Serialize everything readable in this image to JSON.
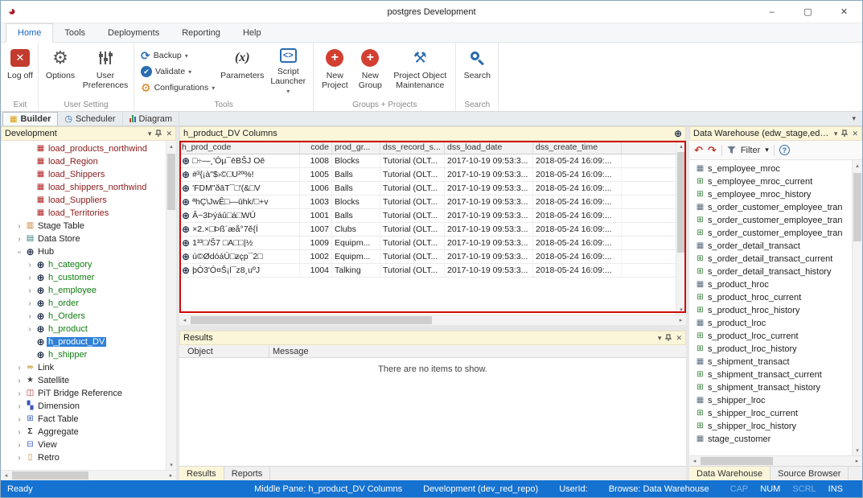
{
  "window": {
    "title": "postgres  Development"
  },
  "colors": {
    "accent": "#1e66c1",
    "statusbar": "#1572d0",
    "selection": "#2f80d8",
    "annotation": "#cf0a0a",
    "panel_header": "#fbf6d9",
    "load_text": "#8b1a1a",
    "hub_object_text": "#107c10"
  },
  "icons": {
    "logo": "◕",
    "minimize": "–",
    "maximize": "▢",
    "close": "✕",
    "chevron_down": "▾",
    "chevron_up": "▴",
    "chevron_left": "◂",
    "chevron_right": "▸",
    "expander": "›",
    "logoff": "✕",
    "gear": "⚙",
    "backup": "⟳",
    "check": "✔",
    "parameters": "(x)",
    "script": "<>",
    "plus": "+",
    "wrench": "⚒",
    "builder": "▦",
    "scheduler": "◷",
    "hub": "⊕",
    "load": "▦",
    "stage": "▥",
    "dstore": "▤",
    "link": "∞",
    "sat": "★",
    "pit": "◫",
    "dim": "▚",
    "fact": "⊞",
    "agg": "Σ",
    "view": "⊟",
    "retro": "▯",
    "table": "▦",
    "dwview": "⊞",
    "undo": "↶",
    "redo": "↷",
    "help": "?"
  },
  "menu": {
    "tabs": [
      "Home",
      "Tools",
      "Deployments",
      "Reporting",
      "Help"
    ],
    "selected_index": 0
  },
  "ribbon": {
    "exit": {
      "label": "Exit",
      "logoff": "Log off"
    },
    "user_setting": {
      "label": "User Setting",
      "options": "Options",
      "user_preferences": "User Preferences"
    },
    "tools": {
      "label": "Tools",
      "backup": "Backup",
      "validate": "Validate",
      "configurations": "Configurations",
      "parameters": "Parameters",
      "script_launcher": "Script Launcher"
    },
    "groups_projects": {
      "label": "Groups + Projects",
      "new_project": "New Project",
      "new_group": "New Group",
      "maintenance": "Project Object Maintenance"
    },
    "search": {
      "label": "Search",
      "search": "Search"
    }
  },
  "view_tabs": {
    "tabs": [
      "Builder",
      "Scheduler",
      "Diagram"
    ],
    "selected": "Builder"
  },
  "panels": {
    "development": {
      "title": "Development"
    },
    "columns": {
      "title": "h_product_DV Columns"
    },
    "results": {
      "title": "Results",
      "columns": [
        "Object",
        "Message"
      ],
      "empty_text": "There are no items to show.",
      "tabs": [
        "Results",
        "Reports"
      ],
      "selected_tab": "Results"
    },
    "browser": {
      "title": "Data Warehouse (edw_stage,edw_ods...",
      "filter_label": "Filter",
      "tabs": [
        "Data Warehouse",
        "Source Browser"
      ],
      "selected_tab": "Data Warehouse"
    }
  },
  "dev_tree": {
    "items": [
      {
        "label": "load_products_northwind",
        "icon": "load",
        "indent": 2,
        "cls": "load"
      },
      {
        "label": "load_Region",
        "icon": "load",
        "indent": 2,
        "cls": "load"
      },
      {
        "label": "load_Shippers",
        "icon": "load",
        "indent": 2,
        "cls": "load"
      },
      {
        "label": "load_shippers_northwind",
        "icon": "load",
        "indent": 2,
        "cls": "load"
      },
      {
        "label": "load_Suppliers",
        "icon": "load",
        "indent": 2,
        "cls": "load"
      },
      {
        "label": "load_Territories",
        "icon": "load",
        "indent": 2,
        "cls": "load"
      },
      {
        "label": "Stage Table",
        "icon": "stage",
        "indent": 1,
        "expander": "collapsed"
      },
      {
        "label": "Data Store",
        "icon": "dstore",
        "indent": 1,
        "expander": "collapsed"
      },
      {
        "label": "Hub",
        "icon": "hub",
        "indent": 1,
        "expander": "expanded"
      },
      {
        "label": "h_category",
        "icon": "hub",
        "indent": 2,
        "expander": "collapsed",
        "cls": "hubobj"
      },
      {
        "label": "h_customer",
        "icon": "hub",
        "indent": 2,
        "expander": "collapsed",
        "cls": "hubobj"
      },
      {
        "label": "h_employee",
        "icon": "hub",
        "indent": 2,
        "expander": "collapsed",
        "cls": "hubobj"
      },
      {
        "label": "h_order",
        "icon": "hub",
        "indent": 2,
        "expander": "collapsed",
        "cls": "hubobj"
      },
      {
        "label": "h_Orders",
        "icon": "hub",
        "indent": 2,
        "expander": "collapsed",
        "cls": "hubobj"
      },
      {
        "label": "h_product",
        "icon": "hub",
        "indent": 2,
        "expander": "collapsed",
        "cls": "hubobj"
      },
      {
        "label": "h_product_DV",
        "icon": "hub",
        "indent": 2,
        "cls": "hubobj",
        "selected": true
      },
      {
        "label": "h_shipper",
        "icon": "hub",
        "indent": 2,
        "cls": "hubobj"
      },
      {
        "label": "Link",
        "icon": "link",
        "indent": 1,
        "expander": "collapsed"
      },
      {
        "label": "Satellite",
        "icon": "sat",
        "indent": 1,
        "expander": "collapsed"
      },
      {
        "label": "PiT Bridge Reference",
        "icon": "pit",
        "indent": 1,
        "expander": "collapsed"
      },
      {
        "label": "Dimension",
        "icon": "dim",
        "indent": 1,
        "expander": "collapsed"
      },
      {
        "label": "Fact Table",
        "icon": "fact",
        "indent": 1,
        "expander": "collapsed"
      },
      {
        "label": "Aggregate",
        "icon": "agg",
        "indent": 1,
        "expander": "collapsed"
      },
      {
        "label": "View",
        "icon": "view",
        "indent": 1,
        "expander": "collapsed"
      },
      {
        "label": "Retro",
        "icon": "retro",
        "indent": 1,
        "expander": "collapsed"
      }
    ]
  },
  "grid": {
    "columns": [
      "h_prod_code",
      "code",
      "prod_gr...",
      "dss_record_s...",
      "dss_load_date",
      "dss_create_time"
    ],
    "rows": [
      [
        "□÷—¸'Óµ¯ēBŠJ  Oē",
        "1008",
        "Blocks",
        "Tutorial (OLT...",
        "2017-10-19 09:53:3...",
        "2018-05-24 16:09:..."
      ],
      [
        "#³{¡à\"$›©□U²º%!",
        "1005",
        "Balls",
        "Tutorial (OLT...",
        "2017-10-19 09:53:3...",
        "2018-05-24 16:09:..."
      ],
      [
        "'FDM\"ðāT¯□'(&□V",
        "1006",
        "Balls",
        "Tutorial (OLT...",
        "2017-10-19 09:53:3...",
        "2018-05-24 16:09:..."
      ],
      [
        "ªhÇ\\JwÊ□—ūhk/□+v",
        "1003",
        "Blocks",
        "Tutorial (OLT...",
        "2017-10-19 09:53:3...",
        "2018-05-24 16:09:..."
      ],
      [
        "Â~3Þýáû□á□WÚ",
        "1001",
        "Balls",
        "Tutorial (OLT...",
        "2017-10-19 09:53:3...",
        "2018-05-24 16:09:..."
      ],
      [
        "×2.×□Þß´æå°7ě{Í",
        "1007",
        "Clubs",
        "Tutorial (OLT...",
        "2017-10-19 09:53:3...",
        "2018-05-24 16:09:..."
      ],
      [
        "1³³□/Š7 □A□□|½",
        "1009",
        "Equipm...",
        "Tutorial (OLT...",
        "2017-10-19 09:53:3...",
        "2018-05-24 16:09:..."
      ],
      [
        "ú©ØdóáÙ□ƶçp¯2□",
        "1002",
        "Equipm...",
        "Tutorial (OLT...",
        "2017-10-19 09:53:3...",
        "2018-05-24 16:09:..."
      ],
      [
        "þÓ3'Ó¤Š¡l¯z8¸uºJ",
        "1004",
        "Talking",
        "Tutorial (OLT...",
        "2017-10-19 09:53:3...",
        "2018-05-24 16:09:..."
      ]
    ]
  },
  "dw_tree": {
    "items": [
      {
        "label": "s_employee_mroc",
        "icon": "table"
      },
      {
        "label": "s_employee_mroc_current",
        "icon": "dwview"
      },
      {
        "label": "s_employee_mroc_history",
        "icon": "dwview"
      },
      {
        "label": "s_order_customer_employee_tran",
        "icon": "table"
      },
      {
        "label": "s_order_customer_employee_tran",
        "icon": "dwview"
      },
      {
        "label": "s_order_customer_employee_tran",
        "icon": "dwview"
      },
      {
        "label": "s_order_detail_transact",
        "icon": "table"
      },
      {
        "label": "s_order_detail_transact_current",
        "icon": "dwview"
      },
      {
        "label": "s_order_detail_transact_history",
        "icon": "dwview"
      },
      {
        "label": "s_product_hroc",
        "icon": "table"
      },
      {
        "label": "s_product_hroc_current",
        "icon": "dwview"
      },
      {
        "label": "s_product_hroc_history",
        "icon": "dwview"
      },
      {
        "label": "s_product_lroc",
        "icon": "table"
      },
      {
        "label": "s_product_lroc_current",
        "icon": "dwview"
      },
      {
        "label": "s_product_lroc_history",
        "icon": "dwview"
      },
      {
        "label": "s_shipment_transact",
        "icon": "table"
      },
      {
        "label": "s_shipment_transact_current",
        "icon": "dwview"
      },
      {
        "label": "s_shipment_transact_history",
        "icon": "dwview"
      },
      {
        "label": "s_shipper_lroc",
        "icon": "table"
      },
      {
        "label": "s_shipper_lroc_current",
        "icon": "dwview"
      },
      {
        "label": "s_shipper_lroc_history",
        "icon": "dwview"
      },
      {
        "label": "stage_customer",
        "icon": "table"
      }
    ]
  },
  "status": {
    "left": "Ready",
    "segments": [
      "Middle Pane: h_product_DV Columns",
      "Development (dev_red_repo)",
      "UserId:",
      "Browse: Data Warehouse"
    ],
    "toggles": [
      {
        "label": "CAP",
        "active": false
      },
      {
        "label": "NUM",
        "active": true
      },
      {
        "label": "SCRL",
        "active": false
      },
      {
        "label": "INS",
        "active": true
      }
    ]
  }
}
